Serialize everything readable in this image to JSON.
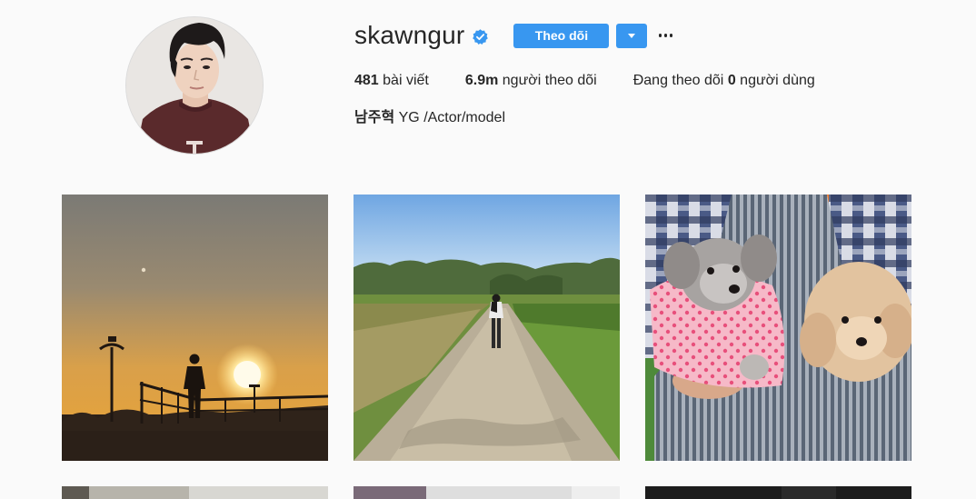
{
  "profile": {
    "username": "skawngur",
    "verified": true,
    "follow_button": "Theo dõi",
    "full_name": "남주혁",
    "bio": "YG /Actor/model"
  },
  "stats": {
    "posts_count": "481",
    "posts_label": "bài viết",
    "followers_count": "6.9m",
    "followers_label": "người theo dõi",
    "following_prefix": "Đang theo dõi",
    "following_count": "0",
    "following_label": "người dùng"
  },
  "icons": {
    "verified": "verified-badge-icon",
    "dropdown": "triangle-down-icon",
    "more": "ellipsis-icon"
  },
  "colors": {
    "accent": "#3897f0",
    "background": "#fafafa",
    "text": "#262626"
  }
}
